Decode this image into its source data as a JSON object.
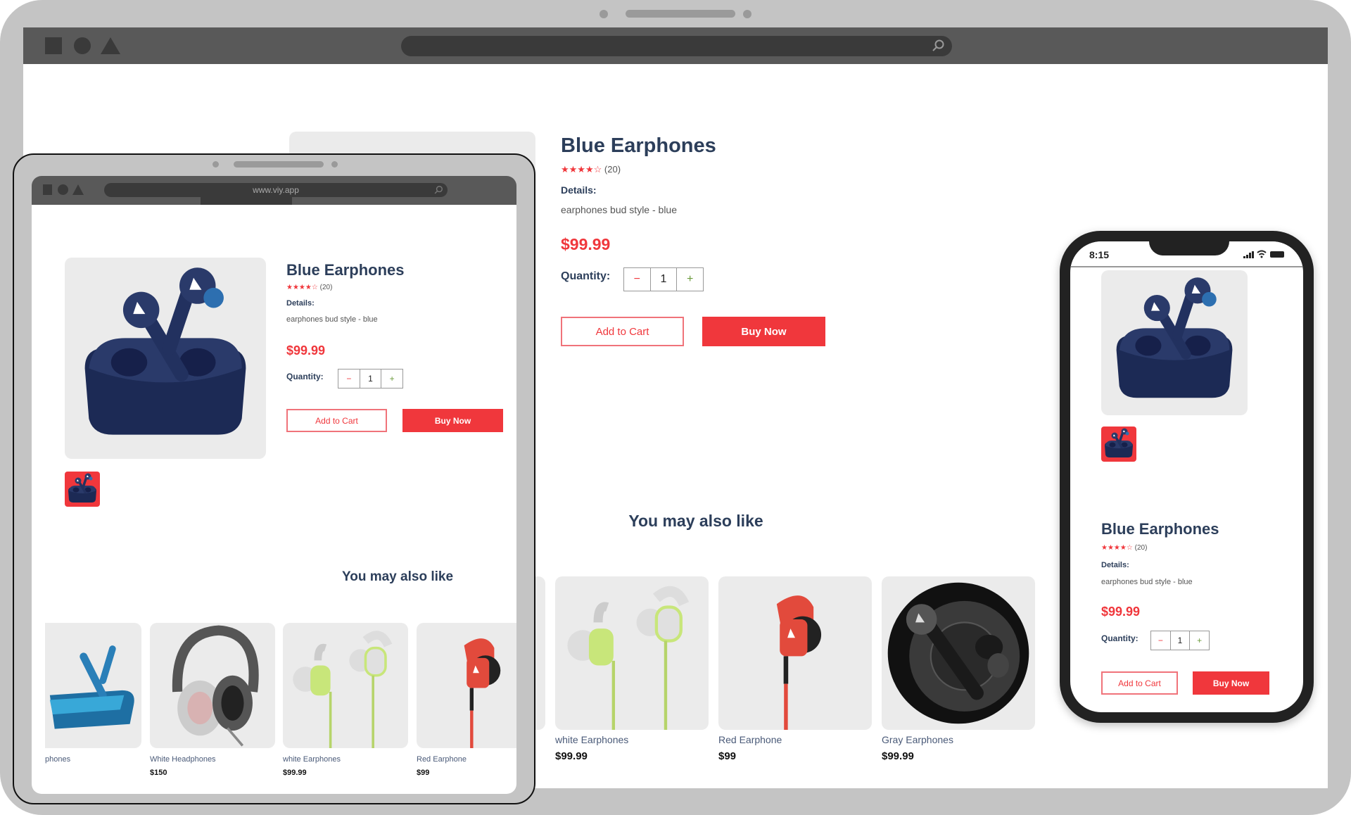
{
  "browser": {
    "tablet_url": "www.viy.app"
  },
  "product": {
    "title": "Blue Earphones",
    "rating": 4,
    "rating_max": 5,
    "reviews": "(20)",
    "details_label": "Details:",
    "description": "earphones bud style - blue",
    "price": "$99.99",
    "quantity_label": "Quantity:",
    "quantity": "1",
    "minus": "−",
    "plus": "+",
    "add_to_cart": "Add to Cart",
    "buy_now": "Buy Now"
  },
  "related": {
    "title": "You may also like",
    "desktop": [
      {
        "name": "white Earphones",
        "price": "$99.99"
      },
      {
        "name": "Red Earphone",
        "price": "$99"
      },
      {
        "name": "Gray Earphones",
        "price": "$99.99"
      }
    ],
    "tablet": [
      {
        "name": "phones",
        "price": ""
      },
      {
        "name": "White Headphones",
        "price": "$150"
      },
      {
        "name": "white Earphones",
        "price": "$99.99"
      },
      {
        "name": "Red Earphone",
        "price": "$99"
      }
    ]
  },
  "phone": {
    "time": "8:15"
  },
  "colors": {
    "accent": "#f0373c",
    "title": "#2c3e5a",
    "frame": "#c4c4c4",
    "toolbar": "#595959"
  },
  "icons": [
    "square-icon",
    "circle-icon",
    "triangle-icon",
    "search-icon",
    "signal-icon",
    "wifi-icon",
    "battery-icon",
    "star-icon"
  ]
}
